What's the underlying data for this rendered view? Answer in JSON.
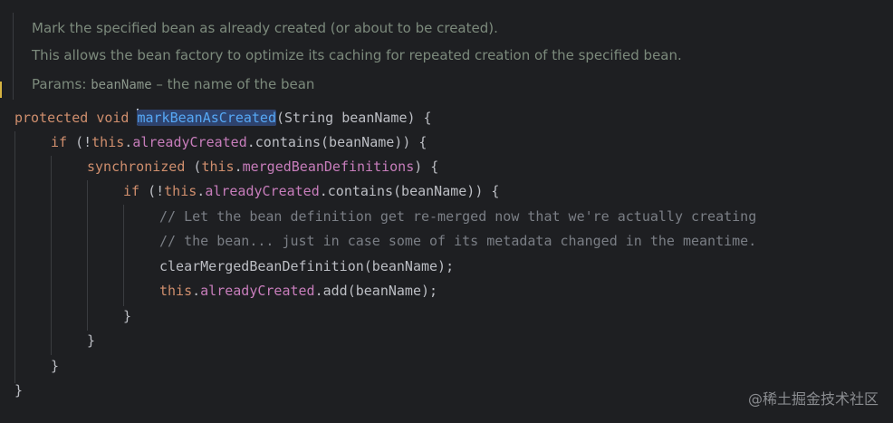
{
  "doc": {
    "line1": "Mark the specified bean as already created (or about to be created).",
    "line2": "This allows the bean factory to optimize its caching for repeated creation of the specified bean.",
    "params_label": "Params:",
    "param_name": "beanName",
    "param_desc": " – the name of the bean"
  },
  "code": {
    "l1": {
      "k1": "protected",
      "k2": "void",
      "method": "markBeanAsCreated",
      "rest": "(String beanName) {"
    },
    "l2": {
      "k": "if",
      "p1": " (!",
      "this": "this",
      "dot": ".",
      "field": "alreadyCreated",
      "rest": ".contains(beanName)) {"
    },
    "l3": {
      "k": "synchronized",
      "p1": " (",
      "this": "this",
      "dot": ".",
      "field": "mergedBeanDefinitions",
      "rest": ") {"
    },
    "l4": {
      "k": "if",
      "p1": " (!",
      "this": "this",
      "dot": ".",
      "field": "alreadyCreated",
      "rest": ".contains(beanName)) {"
    },
    "l5": "// Let the bean definition get re-merged now that we're actually creating",
    "l6": "// the bean... just in case some of its metadata changed in the meantime.",
    "l7": "clearMergedBeanDefinition(beanName);",
    "l8": {
      "this": "this",
      "dot": ".",
      "field": "alreadyCreated",
      "rest": ".add(beanName);"
    },
    "l9": "}",
    "l10": "}",
    "l11": "}",
    "l12": "}"
  },
  "watermark": "@稀土掘金技术社区"
}
